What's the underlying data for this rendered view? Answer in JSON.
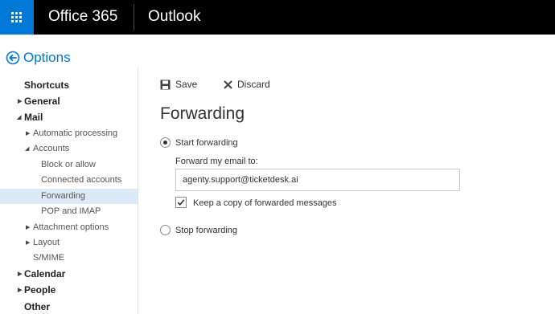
{
  "topbar": {
    "brand": "Office 365",
    "app_name": "Outlook",
    "waffle_icon": "app-launcher-icon"
  },
  "header": {
    "back_label": "Options",
    "back_icon": "back-arrow-circle-icon",
    "accent_color": "#0078d7"
  },
  "sidebar": {
    "items": [
      {
        "label": "Shortcuts",
        "expander": ""
      },
      {
        "label": "General",
        "expander": "▶"
      },
      {
        "label": "Mail",
        "expander": "◢"
      },
      {
        "label": "Automatic processing",
        "expander": "▶"
      },
      {
        "label": "Accounts",
        "expander": "◢"
      },
      {
        "label": "Block or allow",
        "expander": ""
      },
      {
        "label": "Connected accounts",
        "expander": ""
      },
      {
        "label": "Forwarding",
        "expander": "",
        "selected": true
      },
      {
        "label": "POP and IMAP",
        "expander": ""
      },
      {
        "label": "Attachment options",
        "expander": "▶"
      },
      {
        "label": "Layout",
        "expander": "▶"
      },
      {
        "label": "S/MIME",
        "expander": ""
      },
      {
        "label": "Calendar",
        "expander": "▶"
      },
      {
        "label": "People",
        "expander": "▶"
      },
      {
        "label": "Other",
        "expander": ""
      }
    ],
    "selected_color": "#dceaf7"
  },
  "toolbar": {
    "save_label": "Save",
    "discard_label": "Discard"
  },
  "main": {
    "title": "Forwarding",
    "start_forwarding_label": "Start forwarding",
    "start_forwarding_selected": true,
    "forward_to_label": "Forward my email to:",
    "forward_to_value": "agenty.support@ticketdesk.ai",
    "keep_copy_label": "Keep a copy of forwarded messages",
    "keep_copy_checked": true,
    "stop_forwarding_label": "Stop forwarding",
    "stop_forwarding_selected": false
  }
}
